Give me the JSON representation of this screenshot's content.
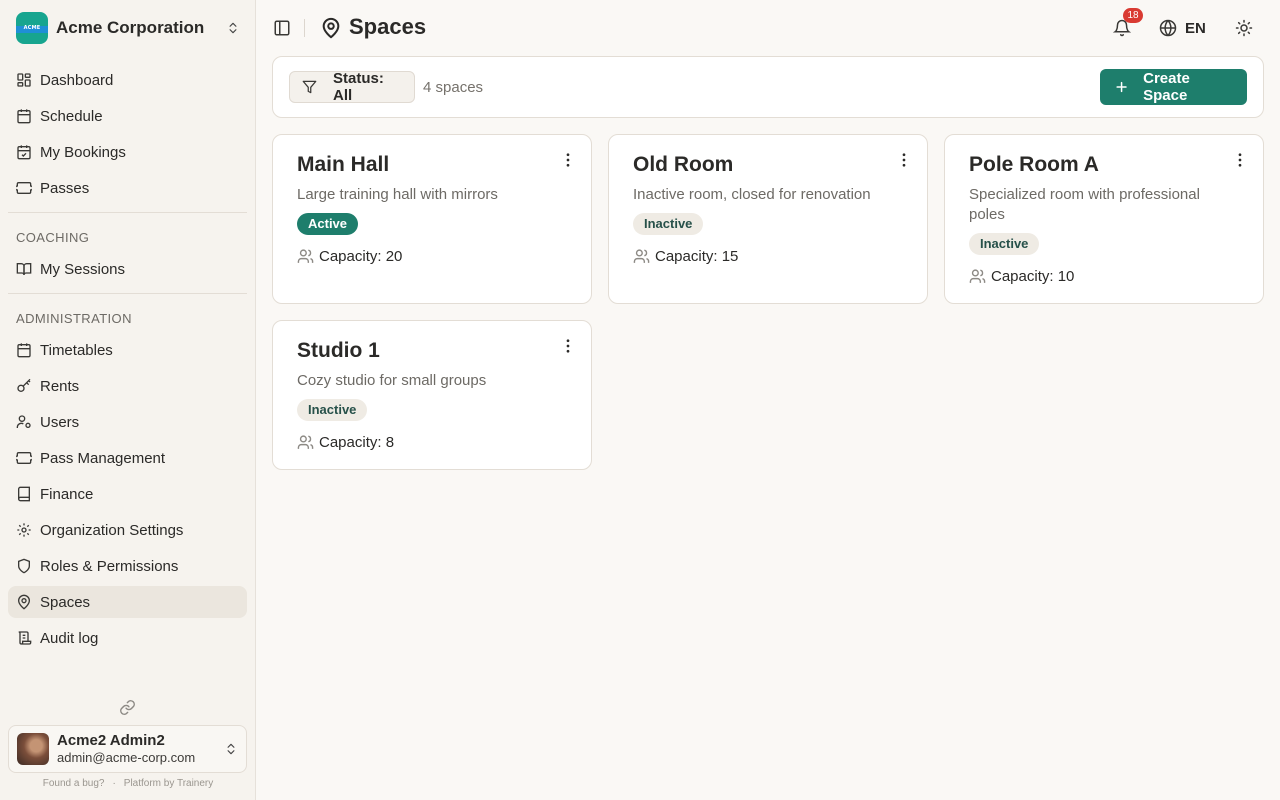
{
  "org": {
    "name": "Acme Corporation",
    "logo_text": "ACME"
  },
  "sidebar": {
    "main": [
      {
        "label": "Dashboard",
        "icon": "dashboard-icon"
      },
      {
        "label": "Schedule",
        "icon": "calendar-icon"
      },
      {
        "label": "My Bookings",
        "icon": "calendar-check-icon"
      },
      {
        "label": "Passes",
        "icon": "ticket-icon"
      }
    ],
    "coaching_label": "COACHING",
    "coaching": [
      {
        "label": "My Sessions",
        "icon": "book-open-icon"
      }
    ],
    "admin_label": "ADMINISTRATION",
    "admin": [
      {
        "label": "Timetables",
        "icon": "calendar-grid-icon"
      },
      {
        "label": "Rents",
        "icon": "key-icon"
      },
      {
        "label": "Users",
        "icon": "user-cog-icon"
      },
      {
        "label": "Pass Management",
        "icon": "ticket-icon"
      },
      {
        "label": "Finance",
        "icon": "book-icon"
      },
      {
        "label": "Organization Settings",
        "icon": "gear-icon"
      },
      {
        "label": "Roles & Permissions",
        "icon": "shield-icon"
      },
      {
        "label": "Spaces",
        "icon": "map-pin-icon",
        "active": true
      },
      {
        "label": "Audit log",
        "icon": "scroll-icon"
      }
    ]
  },
  "user": {
    "name": "Acme2 Admin2",
    "email": "admin@acme-corp.com"
  },
  "footer": {
    "bug": "Found a bug?",
    "sep": "·",
    "platform": "Platform by Trainery"
  },
  "header": {
    "title": "Spaces",
    "notifications": "18",
    "language": "EN"
  },
  "toolbar": {
    "filter_label": "Status: All",
    "count": "4 spaces",
    "create_label": "Create Space"
  },
  "colors": {
    "accent": "#1e7e6c",
    "badge_red": "#d93a32"
  },
  "spaces": [
    {
      "name": "Main Hall",
      "description": "Large training hall with mirrors",
      "status": "Active",
      "capacity": "Capacity: 20"
    },
    {
      "name": "Old Room",
      "description": "Inactive room, closed for renovation",
      "status": "Inactive",
      "capacity": "Capacity: 15"
    },
    {
      "name": "Pole Room A",
      "description": "Specialized room with professional poles",
      "status": "Inactive",
      "capacity": "Capacity: 10"
    },
    {
      "name": "Studio 1",
      "description": "Cozy studio for small groups",
      "status": "Inactive",
      "capacity": "Capacity: 8"
    }
  ]
}
